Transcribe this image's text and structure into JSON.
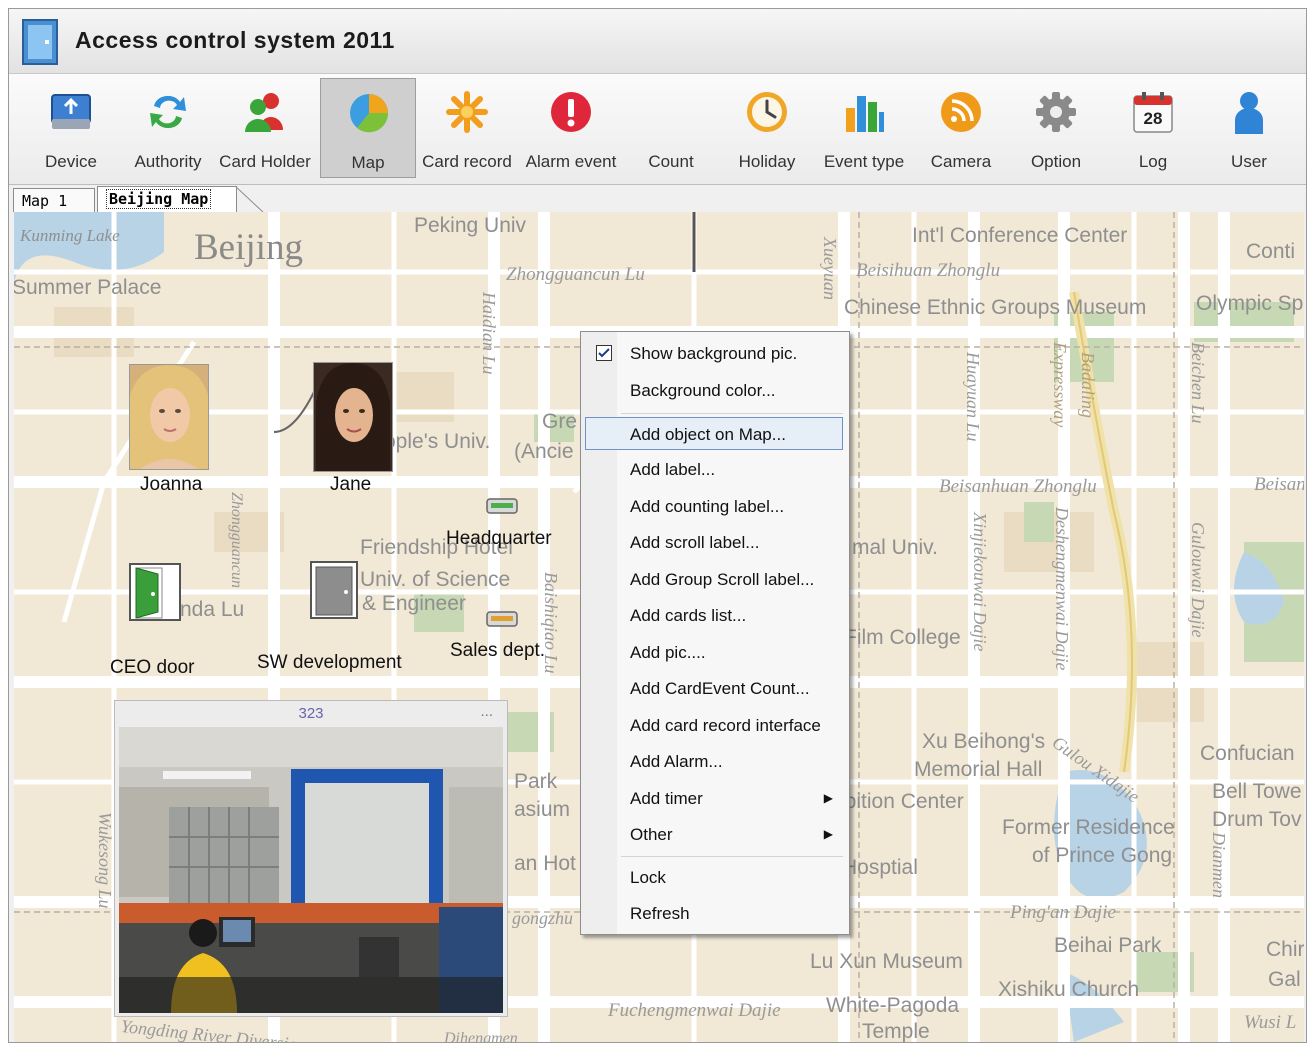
{
  "window": {
    "title": "Access control system 2011"
  },
  "toolbar": {
    "items": [
      {
        "label": "Device",
        "icon": "device-icon"
      },
      {
        "label": "Authority",
        "icon": "authority-icon"
      },
      {
        "label": "Card Holder",
        "icon": "card-holder-icon"
      },
      {
        "label": "Map",
        "icon": "map-icon",
        "active": true
      },
      {
        "label": "Card record",
        "icon": "card-record-icon"
      },
      {
        "label": "Alarm event",
        "icon": "alarm-icon"
      },
      {
        "label": "Count",
        "icon": "count-icon"
      },
      {
        "label": "Holiday",
        "icon": "holiday-icon"
      },
      {
        "label": "Event type",
        "icon": "event-type-icon"
      },
      {
        "label": "Camera",
        "icon": "camera-icon"
      },
      {
        "label": "Option",
        "icon": "option-icon"
      },
      {
        "label": "Log",
        "icon": "log-icon"
      },
      {
        "label": "User",
        "icon": "user-icon"
      }
    ],
    "log_day": "28"
  },
  "tabs": [
    {
      "label": "Map 1"
    },
    {
      "label": "Beijing Map",
      "selected": true
    }
  ],
  "map": {
    "labels": [
      "Kunming Lake",
      "Beijing",
      "Summer Palace",
      "Peking Univ",
      "Zhongguancun Lu",
      "Haidian Lu",
      "Xueyuan",
      "Int'l Conference Center",
      "Beisihuan Zhonglu",
      "Chinese Ethnic Groups Museum",
      "Olympic Sp",
      "Conti",
      "Huayuan Lu",
      "Expressway",
      "Badaling",
      "Beichen Lu",
      "Beisanhuan Zhonglu",
      "Beisan",
      "ople's Univ.",
      "Gre",
      "(Ancie",
      "Friendship Hotel",
      "Univ. of Science",
      "& Engineer",
      "nda Lu",
      "Zhongguancun",
      "Baishiqiao Lu",
      "mal Univ.",
      "Film College",
      "Xinjiekouwai Dajie",
      "Deshengmenwai Dajie",
      "Gulouwai Dajie",
      "Xu Beihong's",
      "Memorial Hall",
      "Gulou Xidajie",
      "Confucian",
      "Bell Towe",
      "Drum Tov",
      "ibition Center",
      "Former Residence",
      "of Prince Gong",
      "Hosptial",
      "Ping'an Dajie",
      "Beihai Park",
      "Lu Xun Museum",
      "Xishiku Church",
      "Chir",
      "Gal",
      "White-Pagoda",
      "Temple",
      "Fuchengmenwai Dajie",
      "Wusi L",
      "Yongding River Diversion",
      "Park",
      "asium",
      "an Hot",
      "gongzhu",
      "Wukesong Lu",
      "Dihengmen",
      "Dianmen"
    ]
  },
  "objects": {
    "joanna": "Joanna",
    "jane": "Jane",
    "ceo_door": "CEO door",
    "sw_development": "SW development",
    "headquarter": "Headquarter",
    "sales_dept": "Sales dept."
  },
  "video": {
    "title": "323",
    "menu_dots": "..."
  },
  "context_menu": {
    "items": [
      {
        "label": "Show background pic.",
        "checked": true
      },
      {
        "label": "Background color..."
      },
      {
        "label": "Add object on Map...",
        "highlighted": true
      },
      {
        "label": "Add label..."
      },
      {
        "label": "Add counting label..."
      },
      {
        "label": "Add scroll label..."
      },
      {
        "label": "Add Group Scroll label..."
      },
      {
        "label": "Add cards list..."
      },
      {
        "label": "Add pic...."
      },
      {
        "label": "Add CardEvent Count..."
      },
      {
        "label": "Add card record interface"
      },
      {
        "label": "Add Alarm..."
      },
      {
        "label": "Add timer",
        "submenu": true
      },
      {
        "label": "Other",
        "submenu": true
      },
      {
        "label": "Lock"
      },
      {
        "label": "Refresh"
      }
    ]
  }
}
